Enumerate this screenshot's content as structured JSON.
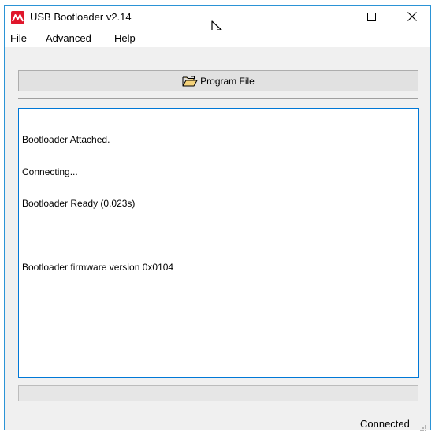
{
  "window": {
    "title": "USB Bootloader v2.14",
    "accent_color": "#0078d7",
    "icon": "microchip-logo-icon"
  },
  "title_buttons": {
    "minimize_icon": "minimize-icon",
    "maximize_icon": "maximize-icon",
    "close_icon": "close-icon"
  },
  "menu": {
    "items": [
      {
        "label": "File"
      },
      {
        "label": "Advanced"
      },
      {
        "label": "Help"
      }
    ]
  },
  "toolbar": {
    "program_button_label": "Program File",
    "program_button_icon": "folder-open-icon"
  },
  "log": {
    "lines": [
      "Bootloader Attached.",
      "Connecting...",
      "Bootloader Ready (0.023s)",
      "",
      "Bootloader firmware version 0x0104"
    ]
  },
  "progress": {
    "value": 0
  },
  "status": {
    "text": "Connected"
  }
}
